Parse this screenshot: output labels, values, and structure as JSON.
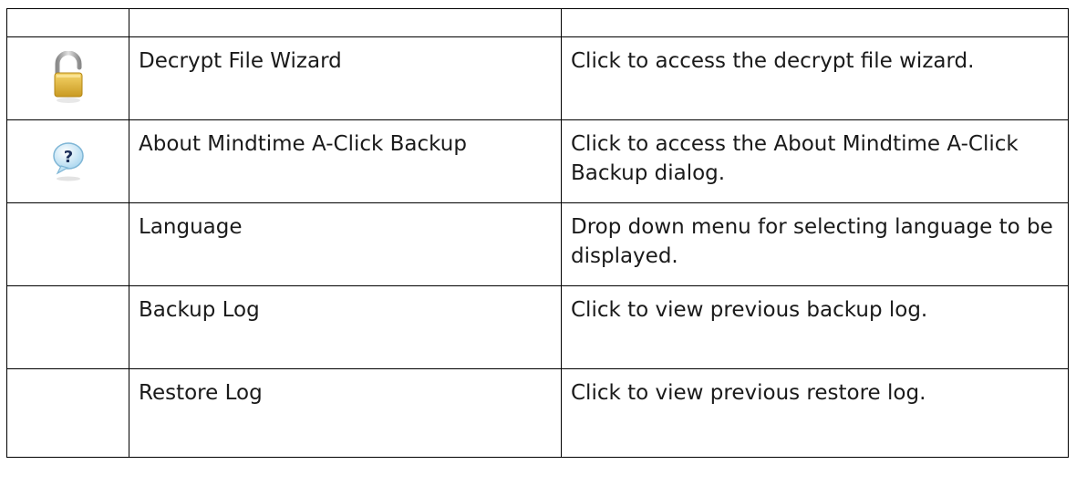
{
  "table": {
    "rows": [
      {
        "icon": "open-padlock-icon",
        "name": "Decrypt File Wizard",
        "description": "Click to access the decrypt file wizard."
      },
      {
        "icon": "help-speech-bubble-icon",
        "name": "About Mindtime A-Click Backup",
        "description": "Click to access the About Mindtime A-Click Backup dialog."
      },
      {
        "icon": "",
        "name": "Language",
        "description": "Drop down menu for selecting language to be displayed."
      },
      {
        "icon": "",
        "name": "Backup Log",
        "description": "Click to view previous backup log."
      },
      {
        "icon": "",
        "name": "Restore Log",
        "description": "Click to view previous restore log."
      }
    ]
  },
  "colors": {
    "border": "#000000",
    "padlock_body": "#e2b93b",
    "padlock_shackle": "#a8a8a8",
    "help_bubble": "#c9e7f7",
    "help_mark": "#1c2f5a"
  }
}
